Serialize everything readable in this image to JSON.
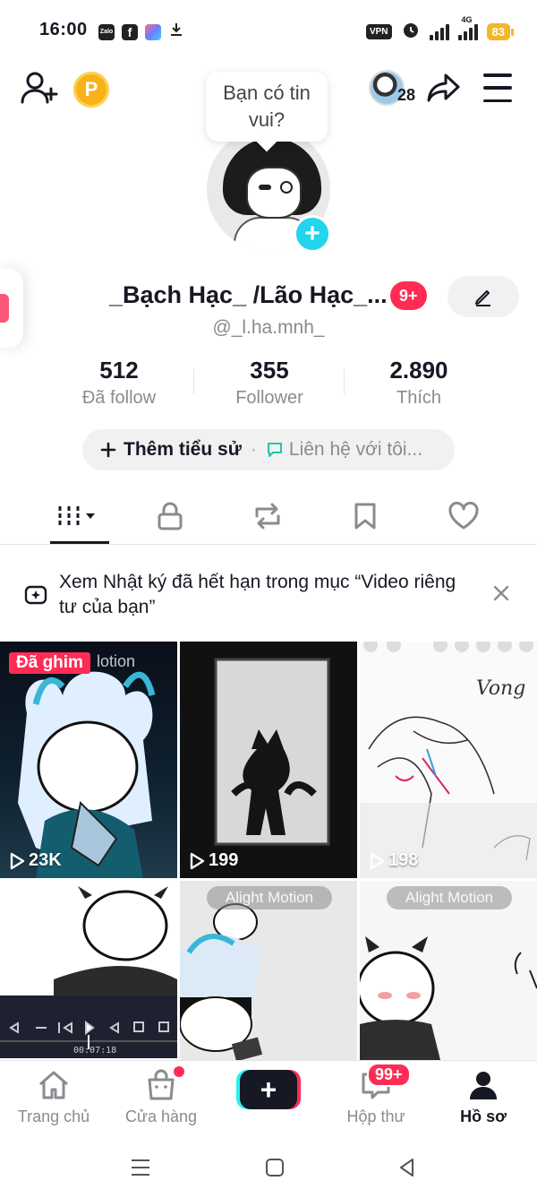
{
  "status_bar": {
    "time": "16:00",
    "app_icons": [
      "zalo-icon",
      "facebook-icon",
      "photos-icon",
      "download-icon"
    ],
    "zalo_text": "Zalo",
    "vpn": "VPN",
    "network": "4G",
    "battery": "83"
  },
  "header": {
    "coin_label": "P",
    "story_count": "28"
  },
  "bubble": {
    "text_line1": "Bạn có tin",
    "text_line2": "vui?"
  },
  "profile": {
    "display_name": "_Bạch Hạc_ /Lão Hạc_...",
    "notif_badge": "9+",
    "handle": "@_l.ha.mnh_",
    "stats": [
      {
        "value": "512",
        "label": "Đã follow"
      },
      {
        "value": "355",
        "label": "Follower"
      },
      {
        "value": "2.890",
        "label": "Thích"
      }
    ],
    "add_bio": "Thêm tiểu sử",
    "separator": "·",
    "contact": "Liên hệ với tôi..."
  },
  "tabs": [
    "videos-grid-icon",
    "lock-icon",
    "repost-icon",
    "bookmark-icon",
    "heart-icon"
  ],
  "notice": {
    "text": "Xem Nhật ký đã hết hạn trong mục “Video riêng tư của bạn”"
  },
  "videos": [
    {
      "views": "23K",
      "pinned_label": "Đã ghim",
      "watermark": "lotion"
    },
    {
      "views": "199"
    },
    {
      "views": "198",
      "caption": "Vong"
    },
    {
      "time_code": "00:07:18"
    },
    {
      "watermark": "Alight Motion"
    },
    {
      "watermark": "Alight Motion"
    }
  ],
  "bottom_nav": {
    "items": [
      {
        "label": "Trang chủ",
        "icon": "home-icon"
      },
      {
        "label": "Cửa hàng",
        "icon": "shop-icon"
      },
      {
        "label": "",
        "icon": "plus-icon"
      },
      {
        "label": "Hộp thư",
        "icon": "inbox-icon",
        "badge": "99+"
      },
      {
        "label": "Hồ sơ",
        "icon": "profile-icon"
      }
    ]
  },
  "colors": {
    "brand_red": "#fe2c55",
    "brand_cyan": "#25f4ee",
    "text_primary": "#161823",
    "text_secondary": "#8a8b91"
  }
}
